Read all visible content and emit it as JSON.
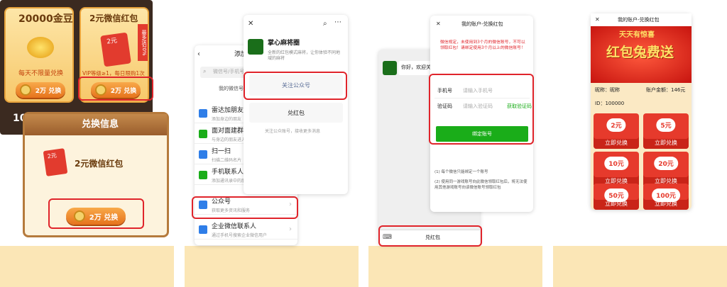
{
  "panel1": {
    "gold_title": "20000金豆",
    "gold_note": "每天不限量兑换",
    "gold_btn": "2万 兑换",
    "red_title": "2元微信红包",
    "ribbon": "最多送20%",
    "card_tag": "2元",
    "red_note": "VIP等级≥1，每日限购1次",
    "red_btn": "2万 兑换",
    "partial": "10",
    "modal_title": "兑换信息",
    "modal_item": "2元微信红包",
    "modal_card": "2元",
    "modal_btn": "2万 兑换"
  },
  "panel2": {
    "add_title": "添加",
    "search_placeholder": "微信号/手机号",
    "my_wechat": "我的微信号：",
    "items": [
      {
        "label": "雷达加朋友",
        "sub": "添加身边的朋友"
      },
      {
        "label": "面对面建群",
        "sub": "与身边的朋友进入同一"
      },
      {
        "label": "扫一扫",
        "sub": "扫描二维码名片"
      },
      {
        "label": "手机联系人",
        "sub": "添加通讯录中的朋友"
      },
      {
        "label": "公众号",
        "sub": "获取更多资讯和服务"
      },
      {
        "label": "企业微信联系人",
        "sub": "通过手机号搜索企业微信用户"
      }
    ],
    "account_name": "掌心麻将圈",
    "account_desc": "全新的红包模式麻将，让你体验不同地域的麻将",
    "follow_btn": "关注公众号",
    "redeem_btn": "兑红包",
    "follow_note": "关注公众账号，接收更多消息"
  },
  "panel3": {
    "greeting": "你好，欢迎关",
    "bottom_btn": "兑红包",
    "close": "✕",
    "title": "我的账户-兑换红包",
    "notice": "微信规定，未使用到3个月的微信账号，不可以领取红包！请绑定使用3个月以上的微信账号！",
    "phone_label": "手机号",
    "phone_placeholder": "请输入手机号",
    "code_label": "验证码",
    "code_placeholder": "请输入验证码",
    "get_code": "获取验证码",
    "bind_btn": "绑定账号",
    "rule1": "(1) 每个微信只能绑定一个账号",
    "rule2": "(2) 使用同一游戏账号向此微信领取红包后，将无法使用其他游戏账号向该微信账号领取红包"
  },
  "panel4": {
    "close": "✕",
    "title": "我的账户-兑换红包",
    "banner_top": "天天有惊喜",
    "banner_main": "红包兔费送",
    "nickname": "昵称：昵称",
    "balance": "账户金额：146元",
    "id": "ID：100000",
    "cards": [
      {
        "v": "2元",
        "ex": "立即兑换"
      },
      {
        "v": "5元",
        "ex": "立即兑换"
      },
      {
        "v": "10元",
        "ex": "立即兑换"
      },
      {
        "v": "20元",
        "ex": "立即兑换"
      },
      {
        "v": "50元",
        "ex": "立即兑换"
      },
      {
        "v": "100元",
        "ex": "立即兑换"
      }
    ]
  },
  "colors": {
    "highlight": "#e0242b",
    "beige": "#fbe6b6",
    "wechat_green": "#1aad19",
    "red": "#e63a2c",
    "orange": "#e6731c"
  }
}
